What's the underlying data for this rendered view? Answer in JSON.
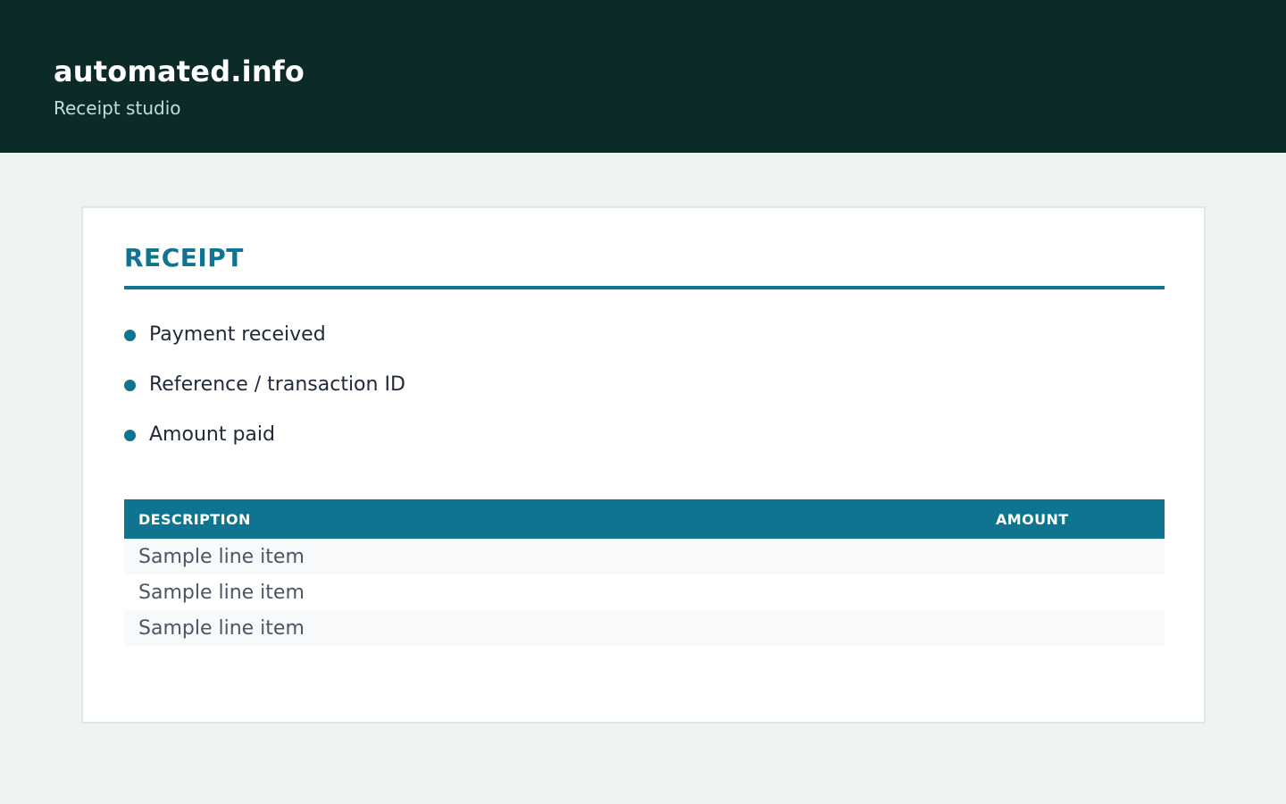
{
  "header": {
    "brand": "automated.info",
    "subtitle": "Receipt studio"
  },
  "receipt": {
    "title": "RECEIPT",
    "points": [
      {
        "label": "Payment received"
      },
      {
        "label": "Reference / transaction ID"
      },
      {
        "label": "Amount paid"
      }
    ],
    "table": {
      "columns": [
        "DESCRIPTION",
        "AMOUNT"
      ],
      "rows": [
        {
          "description": "Sample line item",
          "amount": ""
        },
        {
          "description": "Sample line item",
          "amount": ""
        },
        {
          "description": "Sample line item",
          "amount": ""
        }
      ]
    }
  },
  "colors": {
    "header_bg": "#0c2a27",
    "accent": "#0f7490",
    "page_bg": "#eff3f2"
  }
}
